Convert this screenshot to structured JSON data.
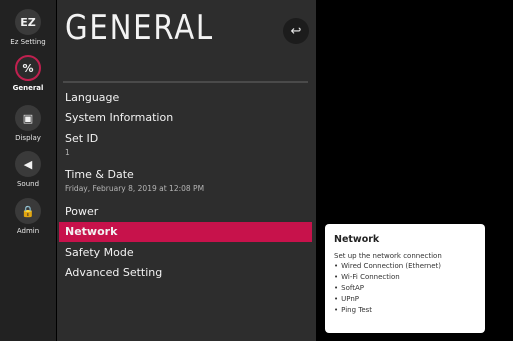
{
  "rail": {
    "items": [
      {
        "icon_name": "ez-setting-icon",
        "glyph": "EZ",
        "label": "Ez Setting",
        "active": false
      },
      {
        "icon_name": "general-icon",
        "glyph": "%",
        "label": "General",
        "active": true
      },
      {
        "icon_name": "display-icon",
        "glyph": "▣",
        "label": "Display",
        "active": false
      },
      {
        "icon_name": "sound-icon",
        "glyph": "◀",
        "label": "Sound",
        "active": false
      },
      {
        "icon_name": "admin-icon",
        "glyph": "🔒",
        "label": "Admin",
        "active": false
      }
    ]
  },
  "panel": {
    "title": "GENERAL",
    "back_icon": "↩",
    "menu": [
      {
        "label": "Language",
        "sub": ""
      },
      {
        "label": "System Information",
        "sub": ""
      },
      {
        "label": "Set ID",
        "sub": "1"
      },
      {
        "label": "Time & Date",
        "sub": "Friday, February 8, 2019 at 12:08 PM"
      },
      {
        "label": "Power",
        "sub": ""
      },
      {
        "label": "Network",
        "sub": ""
      },
      {
        "label": "Safety Mode",
        "sub": ""
      },
      {
        "label": "Advanced Setting",
        "sub": ""
      }
    ],
    "selected_index": 5
  },
  "info": {
    "title": "Network",
    "description": "Set up the network connection",
    "items": [
      "Wired Connection (Ethernet)",
      "Wi-Fi Connection",
      "SoftAP",
      "UPnP",
      "Ping Test"
    ]
  },
  "colors": {
    "accent": "#c7124b",
    "panel_bg": "#2d2d2d",
    "rail_bg": "#222222",
    "screen_bg": "#000000"
  }
}
